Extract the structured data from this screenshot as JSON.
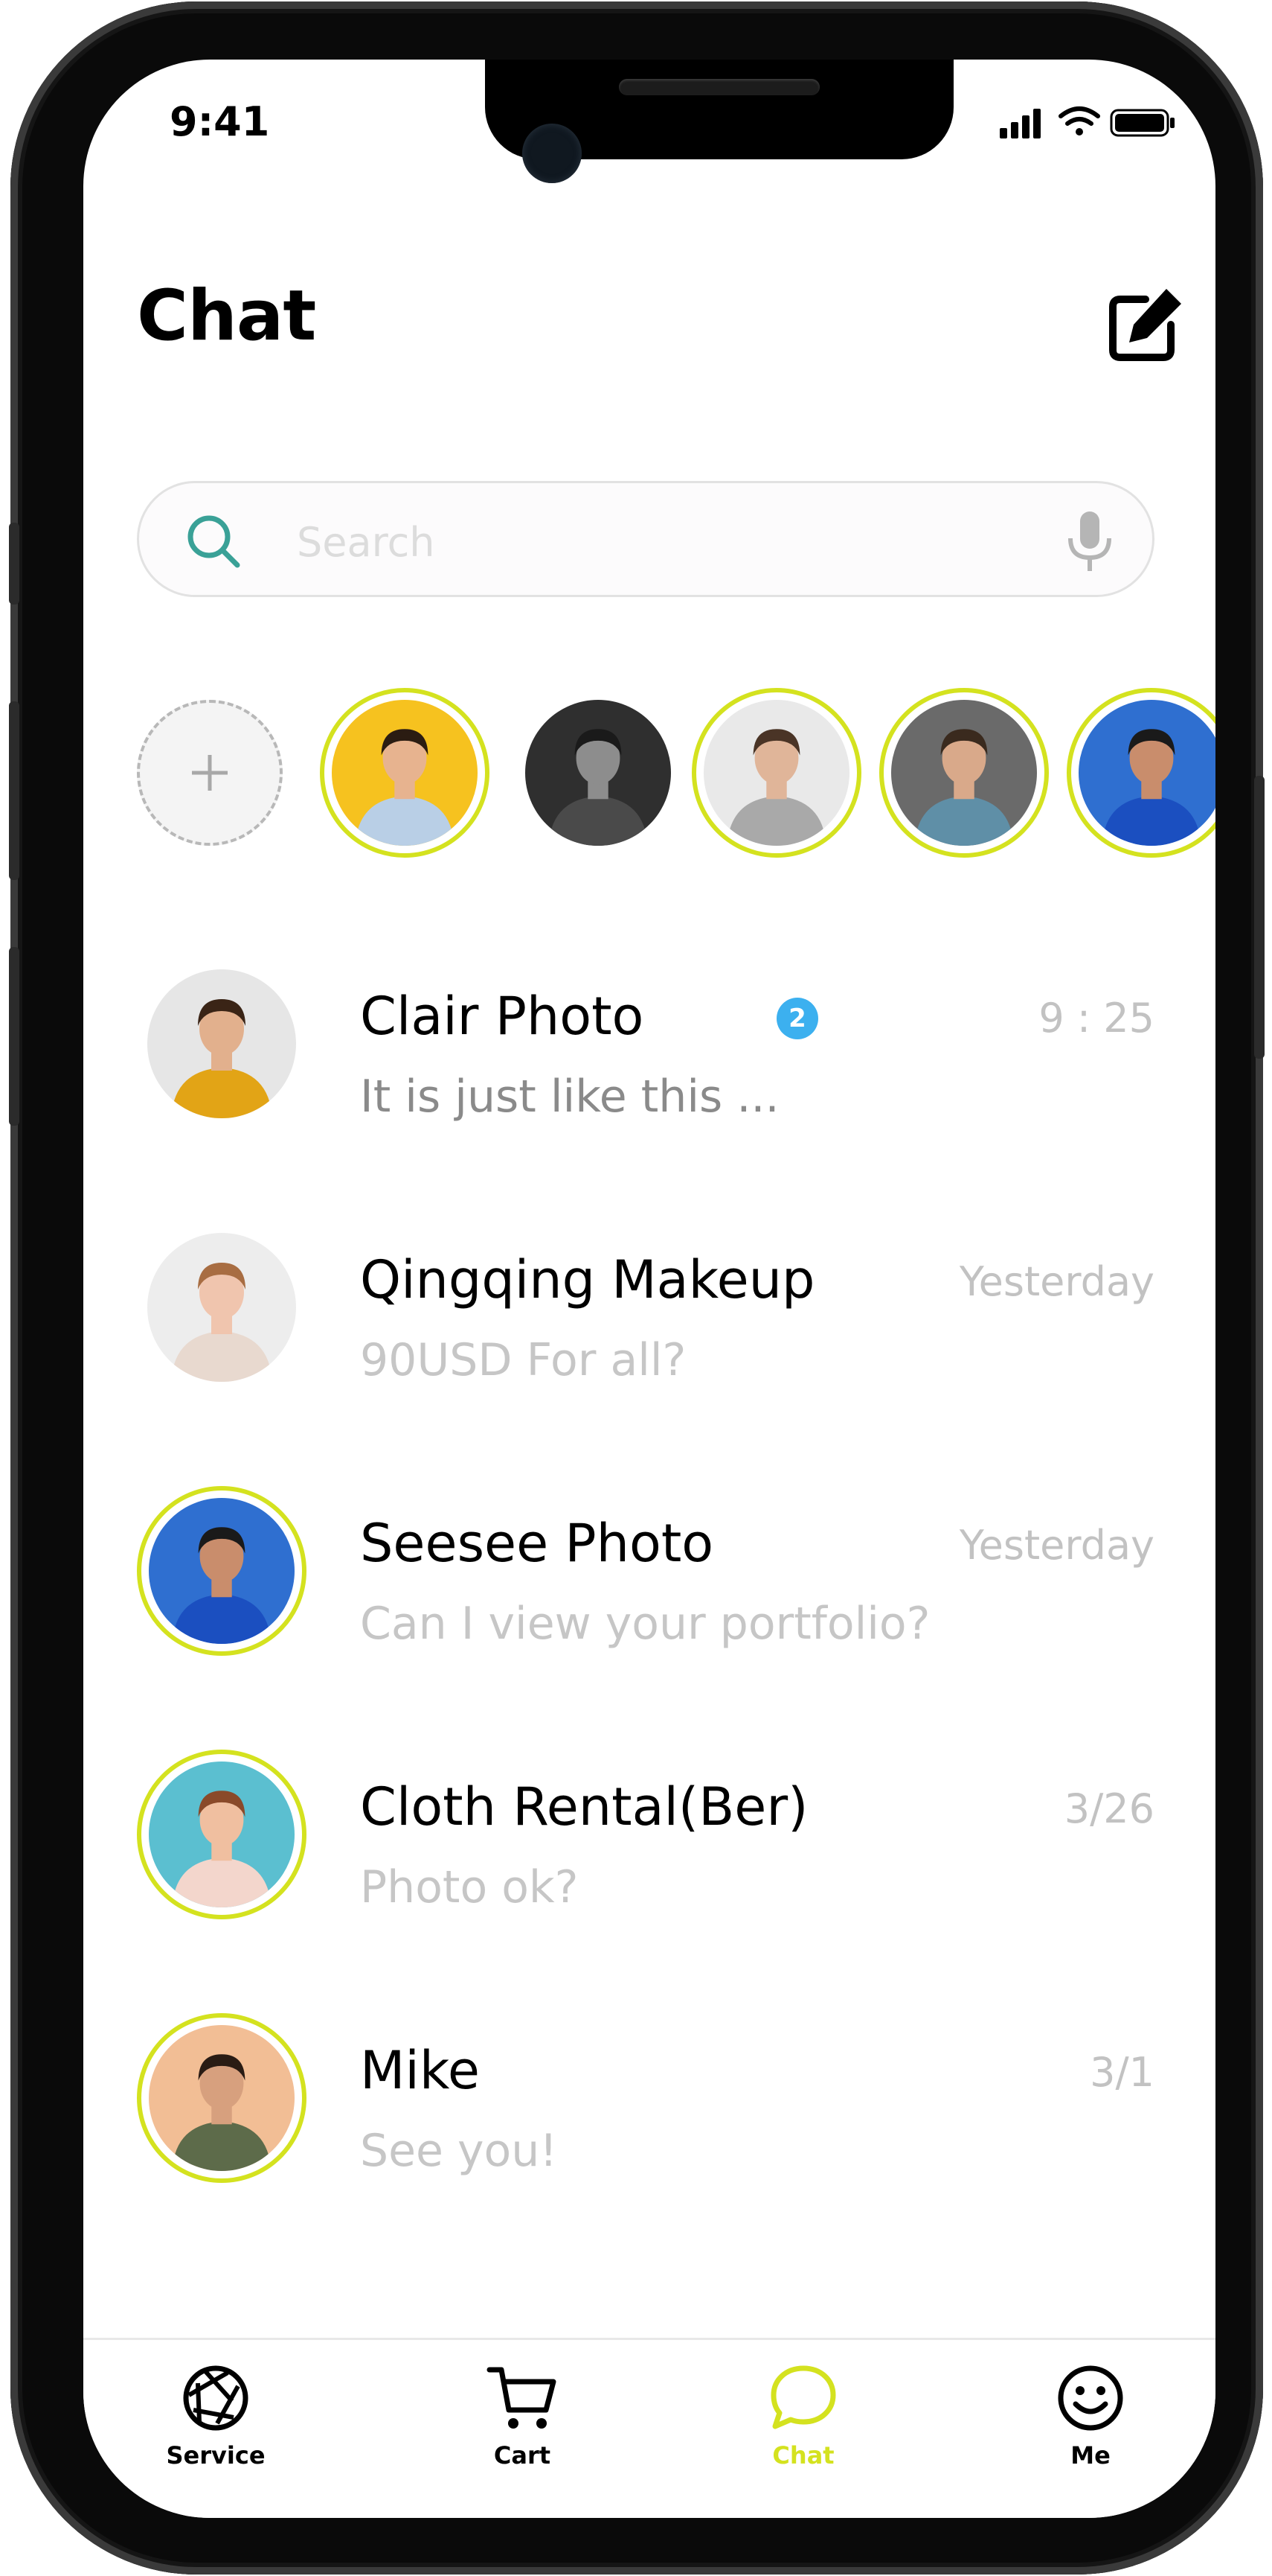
{
  "status_bar": {
    "time": "9:41"
  },
  "header": {
    "title": "Chat"
  },
  "search": {
    "placeholder": "Search"
  },
  "colors": {
    "accent": "#d4e21f",
    "badge": "#3cb0ef",
    "muted_text": "#c6c6c6"
  },
  "stories": [
    {
      "type": "add"
    },
    {
      "ring": true,
      "bg": "#f6c21f",
      "shirt": "#b9cfe6",
      "skin": "#e7b38f",
      "hair": "#2b1c12"
    },
    {
      "ring": false,
      "bg": "#2f2f2f",
      "shirt": "#4a4a4a",
      "skin": "#8d8d8d",
      "hair": "#1a1a1a"
    },
    {
      "ring": true,
      "bg": "#e9e9e9",
      "shirt": "#a9a9a9",
      "skin": "#e0b599",
      "hair": "#4a3426"
    },
    {
      "ring": true,
      "bg": "#6a6a6a",
      "shirt": "#5f8fa7",
      "skin": "#d9a98a",
      "hair": "#3a2a1e"
    },
    {
      "ring": true,
      "bg": "#2f6fd0",
      "shirt": "#1b4fc0",
      "skin": "#c98d6c",
      "hair": "#1a1a1a"
    }
  ],
  "chats": [
    {
      "name": "Clair Photo",
      "message": "It is just like this ...",
      "time": "9 : 25",
      "badge": "2",
      "unread": true,
      "ring": false,
      "bg": "#e6e6e6",
      "shirt": "#e2a416",
      "skin": "#e2b08d",
      "hair": "#3a2416"
    },
    {
      "name": "Qingqing Makeup",
      "message": "90USD For all?",
      "time": "Yesterday",
      "unread": false,
      "ring": false,
      "bg": "#ededed",
      "shirt": "#e8d9cf",
      "skin": "#f0c5ae",
      "hair": "#a86d42"
    },
    {
      "name": "Seesee Photo",
      "message": "Can I view your portfolio?",
      "time": "Yesterday",
      "unread": false,
      "ring": true,
      "bg": "#2f6fd0",
      "shirt": "#1b4fc0",
      "skin": "#c98d6c",
      "hair": "#1a1a1a"
    },
    {
      "name": "Cloth Rental(Ber)",
      "message": "Photo ok?",
      "time": "3/26",
      "unread": false,
      "ring": true,
      "bg": "#5bbfd0",
      "shirt": "#f3d6cc",
      "skin": "#f0bfa0",
      "hair": "#8a4a2a"
    },
    {
      "name": "Mike",
      "message": "See you!",
      "time": "3/1",
      "unread": false,
      "ring": true,
      "bg": "#f2be95",
      "shirt": "#5d6b4a",
      "skin": "#d7a07e",
      "hair": "#2a1c14"
    }
  ],
  "tabs": [
    {
      "label": "Service",
      "icon": "aperture-icon",
      "active": false
    },
    {
      "label": "Cart",
      "icon": "cart-icon",
      "active": false
    },
    {
      "label": "Chat",
      "icon": "chat-bubble-icon",
      "active": true
    },
    {
      "label": "Me",
      "icon": "smiley-icon",
      "active": false
    }
  ]
}
